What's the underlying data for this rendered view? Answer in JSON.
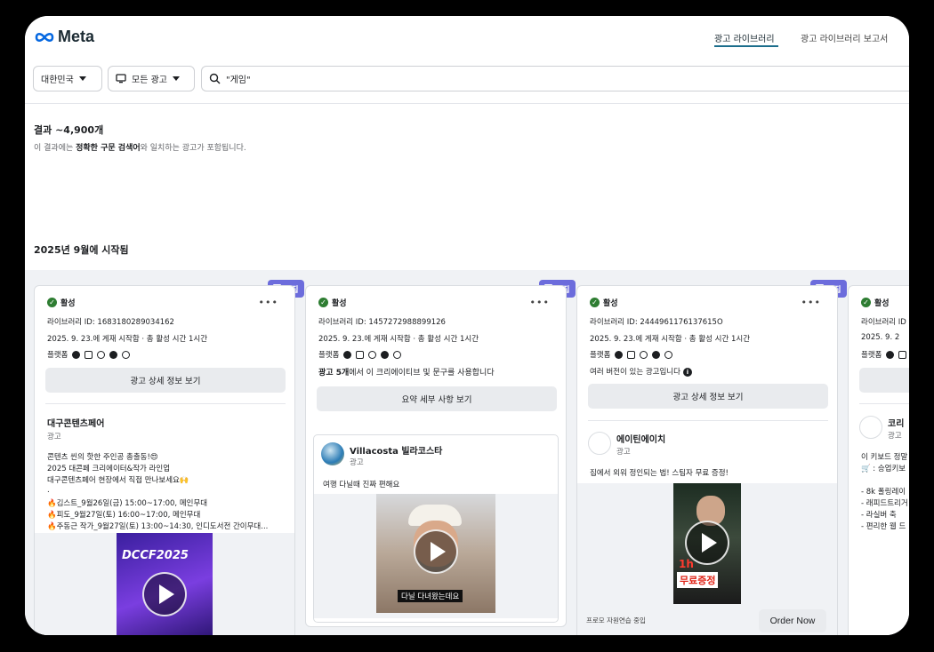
{
  "header": {
    "logo_text": "Meta",
    "tabs": [
      {
        "label": "광고 라이브러리",
        "active": true
      },
      {
        "label": "광고 라이브러리 보고서",
        "active": false
      }
    ]
  },
  "filters": {
    "country": "대한민국",
    "ad_type": "모든 광고",
    "search_value": "\"게임\""
  },
  "results": {
    "title": "결과 ~4,900개",
    "note_prefix": "이 결과에는 ",
    "note_bold": "정확한 구문 검색어",
    "note_suffix": "와 일치하는 광고가 포함됩니다."
  },
  "section_title": "2025년 9월에 시작됨",
  "colors": {
    "accent": "#1c6e8c",
    "tag": "#6c6cdc",
    "active_green": "#2e7d32"
  },
  "cards": [
    {
      "tag": "수집",
      "status": "활성",
      "library_id": "라이브러리 ID: 1683180289034162",
      "started": "2025. 9. 23.에 게재 시작함 · 총 활성 시간 1시간",
      "platforms_label": "플랫폼",
      "button": "광고 상세 정보 보기",
      "advertiser": "대구콘텐츠페어",
      "advertiser_sub": "광고",
      "body": [
        "콘텐츠 씬의 핫한 주인공 총출동!😍",
        "2025 대콘페 크리에이터&작가 라인업",
        "대구콘텐츠페어 현장에서 직접 만나보세요🙌",
        ".",
        "🔥김스트_9월26일(금) 15:00~17:00, 메인무대",
        "🔥피도_9월27일(토) 16:00~17:00, 메인무대",
        "🔥주동근 작가_9월27일(토) 13:00~14:30, 인디도서전 간이무대..."
      ],
      "media_text": "DCCF2025"
    },
    {
      "tag": "수집",
      "status": "활성",
      "library_id": "라이브러리 ID: 1457272988899126",
      "started": "2025. 9. 23.에 게재 시작함 · 총 활성 시간 1시간",
      "platforms_label": "플랫폼",
      "multi_note_bold": "광고 5개",
      "multi_note_rest": "에서 이 크리에이티브 및 문구를 사용합니다",
      "button": "요약 세부 사항 보기",
      "advertiser": "Villacosta 빌라코스타",
      "advertiser_sub": "광고",
      "body": [
        "여행 다닐때 진짜 편해요"
      ],
      "media_caption": "다닐 다녀왔는데요"
    },
    {
      "tag": "수집",
      "status": "활성",
      "library_id": "라이브러리 ID: 2444961176137615O",
      "started": "2025. 9. 23.에 게재 시작함 · 총 활성 시간 1시간",
      "platforms_label": "플랫폼",
      "versions_note": "여러 버전이 있는 광고입니다",
      "button": "광고 상세 정보 보기",
      "advertiser": "에이틴에이치",
      "advertiser_sub": "광고",
      "body": [
        "집에서 외워 정인되는 법! 스팀자 무료 증정!"
      ],
      "media_caption_1": "1h",
      "media_caption_2": "무료증정",
      "footer_note": "프로모 자원연습 중입",
      "cta": "Order Now"
    },
    {
      "status": "활성",
      "library_id": "라이브러리 ID",
      "started": "2025. 9. 2",
      "platforms_label": "플랫폼",
      "advertiser": "코리",
      "advertiser_sub": "광고",
      "body": [
        "이 키보드 정말",
        "🛒 : 승업키보",
        "",
        "- 8k 폴링레이",
        "- 래피드트리거",
        "- 라실버 축",
        "- 편리한 웹 드"
      ]
    }
  ]
}
